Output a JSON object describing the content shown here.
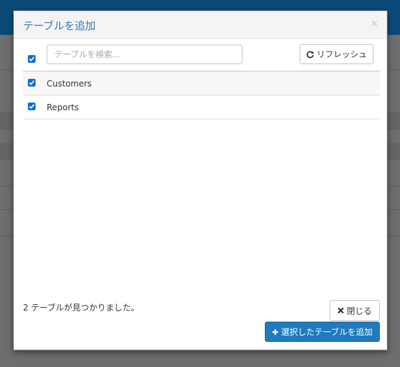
{
  "modal": {
    "title": "テーブルを追加",
    "close_glyph": "×"
  },
  "search": {
    "placeholder": "テーブルを検索..."
  },
  "toolbar": {
    "refresh_label": "リフレッシュ",
    "select_all_checked": true
  },
  "tables": [
    {
      "name": "Customers",
      "checked": true
    },
    {
      "name": "Reports",
      "checked": true
    }
  ],
  "footer": {
    "status": "2 テーブルが見つかりました。",
    "close_label": "閉じる",
    "add_label": "選択したテーブルを追加"
  },
  "icons": {
    "refresh": "refresh-icon",
    "close": "close-icon",
    "add": "plus-icon",
    "checkbox": "checkbox-checked-icon"
  },
  "colors": {
    "accent": "#337ab7",
    "primary_button": "#1f7bbd",
    "checkbox": "#0b6fd6",
    "topbar": "#0b4a78"
  }
}
